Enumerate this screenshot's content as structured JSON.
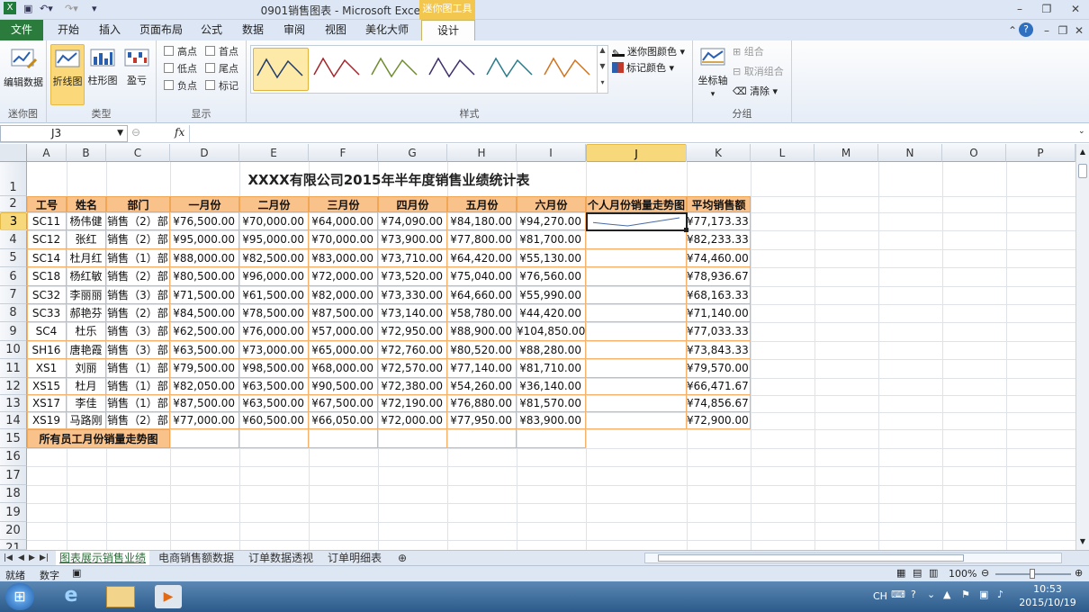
{
  "window": {
    "title": "0901销售图表 - Microsoft Excel",
    "context_tab": "迷你图工具"
  },
  "ribbon_tabs": {
    "file": "文件",
    "items": [
      "开始",
      "插入",
      "页面布局",
      "公式",
      "数据",
      "审阅",
      "视图",
      "美化大师",
      "设计"
    ]
  },
  "ribbon": {
    "edit_data": "编辑数据",
    "group_sparkline": "迷你图",
    "type_line": "折线图",
    "type_column": "柱形图",
    "type_winloss": "盈亏",
    "group_type": "类型",
    "show": {
      "high": "高点",
      "low": "低点",
      "negative": "负点",
      "first": "首点",
      "last": "尾点",
      "markers": "标记"
    },
    "group_show": "显示",
    "group_style": "样式",
    "sparkline_color": "迷你图颜色",
    "marker_color": "标记颜色",
    "axis": "坐标轴",
    "group_btn": "组合",
    "ungroup_btn": "取消组合",
    "clear_btn": "清除",
    "group_group": "分组"
  },
  "formula": {
    "name_box": "J3",
    "fx": "fx",
    "value": ""
  },
  "columns": [
    "A",
    "B",
    "C",
    "D",
    "E",
    "F",
    "G",
    "H",
    "I",
    "J",
    "K",
    "L",
    "M",
    "N",
    "O",
    "P"
  ],
  "row_numbers": [
    "1",
    "2",
    "3",
    "4",
    "5",
    "6",
    "7",
    "8",
    "9",
    "10",
    "11",
    "12",
    "13",
    "14",
    "15",
    "16",
    "17",
    "18",
    "19",
    "20",
    "21"
  ],
  "table": {
    "title": "XXXX有限公司2015年半年度销售业绩统计表",
    "headers": [
      "工号",
      "姓名",
      "部门",
      "一月份",
      "二月份",
      "三月份",
      "四月份",
      "五月份",
      "六月份",
      "个人月份销量走势图",
      "平均销售额"
    ],
    "rows": [
      {
        "id": "SC11",
        "name": "杨伟健",
        "dept": "销售（2）部",
        "m1": "¥76,500.00",
        "m2": "¥70,000.00",
        "m3": "¥64,000.00",
        "m4": "¥74,090.00",
        "m5": "¥84,180.00",
        "m6": "¥94,270.00",
        "avg": "¥77,173.33"
      },
      {
        "id": "SC12",
        "name": "张红",
        "dept": "销售（2）部",
        "m1": "¥95,000.00",
        "m2": "¥95,000.00",
        "m3": "¥70,000.00",
        "m4": "¥73,900.00",
        "m5": "¥77,800.00",
        "m6": "¥81,700.00",
        "avg": "¥82,233.33"
      },
      {
        "id": "SC14",
        "name": "杜月红",
        "dept": "销售（1）部",
        "m1": "¥88,000.00",
        "m2": "¥82,500.00",
        "m3": "¥83,000.00",
        "m4": "¥73,710.00",
        "m5": "¥64,420.00",
        "m6": "¥55,130.00",
        "avg": "¥74,460.00"
      },
      {
        "id": "SC18",
        "name": "杨红敏",
        "dept": "销售（2）部",
        "m1": "¥80,500.00",
        "m2": "¥96,000.00",
        "m3": "¥72,000.00",
        "m4": "¥73,520.00",
        "m5": "¥75,040.00",
        "m6": "¥76,560.00",
        "avg": "¥78,936.67"
      },
      {
        "id": "SC32",
        "name": "李丽丽",
        "dept": "销售（3）部",
        "m1": "¥71,500.00",
        "m2": "¥61,500.00",
        "m3": "¥82,000.00",
        "m4": "¥73,330.00",
        "m5": "¥64,660.00",
        "m6": "¥55,990.00",
        "avg": "¥68,163.33"
      },
      {
        "id": "SC33",
        "name": "郝艳芬",
        "dept": "销售（2）部",
        "m1": "¥84,500.00",
        "m2": "¥78,500.00",
        "m3": "¥87,500.00",
        "m4": "¥73,140.00",
        "m5": "¥58,780.00",
        "m6": "¥44,420.00",
        "avg": "¥71,140.00"
      },
      {
        "id": "SC4",
        "name": "杜乐",
        "dept": "销售（3）部",
        "m1": "¥62,500.00",
        "m2": "¥76,000.00",
        "m3": "¥57,000.00",
        "m4": "¥72,950.00",
        "m5": "¥88,900.00",
        "m6": "¥104,850.00",
        "avg": "¥77,033.33"
      },
      {
        "id": "SH16",
        "name": "唐艳霞",
        "dept": "销售（3）部",
        "m1": "¥63,500.00",
        "m2": "¥73,000.00",
        "m3": "¥65,000.00",
        "m4": "¥72,760.00",
        "m5": "¥80,520.00",
        "m6": "¥88,280.00",
        "avg": "¥73,843.33"
      },
      {
        "id": "XS1",
        "name": "刘丽",
        "dept": "销售（1）部",
        "m1": "¥79,500.00",
        "m2": "¥98,500.00",
        "m3": "¥68,000.00",
        "m4": "¥72,570.00",
        "m5": "¥77,140.00",
        "m6": "¥81,710.00",
        "avg": "¥79,570.00"
      },
      {
        "id": "XS15",
        "name": "杜月",
        "dept": "销售（1）部",
        "m1": "¥82,050.00",
        "m2": "¥63,500.00",
        "m3": "¥90,500.00",
        "m4": "¥72,380.00",
        "m5": "¥54,260.00",
        "m6": "¥36,140.00",
        "avg": "¥66,471.67"
      },
      {
        "id": "XS17",
        "name": "李佳",
        "dept": "销售（1）部",
        "m1": "¥87,500.00",
        "m2": "¥63,500.00",
        "m3": "¥67,500.00",
        "m4": "¥72,190.00",
        "m5": "¥76,880.00",
        "m6": "¥81,570.00",
        "avg": "¥74,856.67"
      },
      {
        "id": "XS19",
        "name": "马路刚",
        "dept": "销售（2）部",
        "m1": "¥77,000.00",
        "m2": "¥60,500.00",
        "m3": "¥66,050.00",
        "m4": "¥72,000.00",
        "m5": "¥77,950.00",
        "m6": "¥83,900.00",
        "avg": "¥72,900.00"
      }
    ],
    "footer_label": "所有员工月份销量走势图"
  },
  "sheet_tabs": [
    "图表展示销售业绩",
    "电商销售额数据",
    "订单数据透视",
    "订单明细表"
  ],
  "status": {
    "ready": "就绪",
    "mode": "数字",
    "zoom": "100%"
  },
  "taskbar": {
    "lang": "CH",
    "time": "10:53",
    "date": "2015/10/19"
  },
  "colors": {
    "header_fill": "#f9c28b",
    "border": "#f6b26b",
    "accent": "#2a7b3c",
    "selection": "#f7d97b"
  }
}
